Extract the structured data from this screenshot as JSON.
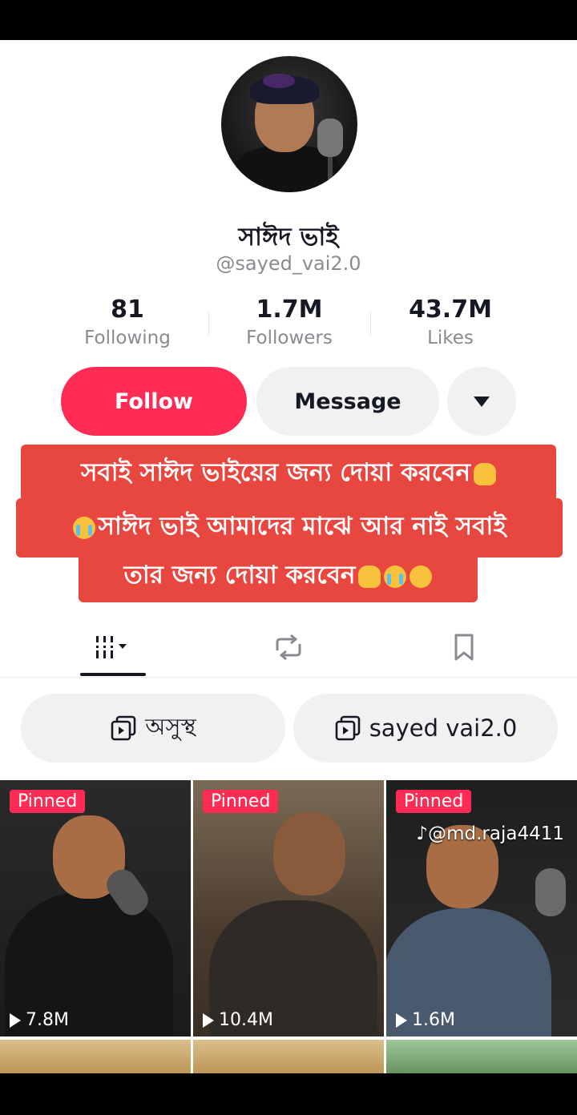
{
  "profile": {
    "name": "সাঈদ ভাই",
    "handle": "@sayed_vai2.0"
  },
  "stats": [
    {
      "value": "81",
      "label": "Following"
    },
    {
      "value": "1.7M",
      "label": "Followers"
    },
    {
      "value": "43.7M",
      "label": "Likes"
    }
  ],
  "actions": {
    "follow": "Follow",
    "message": "Message"
  },
  "caption": {
    "line1": "সবাই সাঈদ ভাইয়ের জন্য দোয়া করবেন",
    "line2": "সাঈদ ভাই আমাদের মাঝে আর নাই সবাই",
    "line3": "তার জন্য দোয়া করবেন"
  },
  "playlists": [
    {
      "label": "অসুস্থ"
    },
    {
      "label": "sayed vai2.0"
    }
  ],
  "videos": [
    {
      "badge": "Pinned",
      "views": "7.8M"
    },
    {
      "badge": "Pinned",
      "views": "10.4M"
    },
    {
      "badge": "Pinned",
      "views": "1.6M"
    }
  ],
  "watermark": "@md.raja4411",
  "colors": {
    "accent": "#fe2c55",
    "caption_bg": "#e8473f",
    "button_bg": "#f1f1f2"
  }
}
